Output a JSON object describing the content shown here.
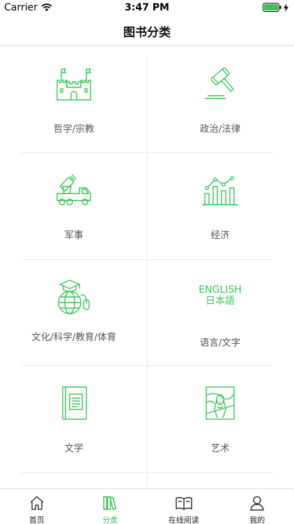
{
  "status_bar": {
    "carrier": "Carrier",
    "time": "3:47 PM"
  },
  "header": {
    "title": "图书分类"
  },
  "categories": [
    {
      "label": "哲学/宗教",
      "icon": "castle-icon"
    },
    {
      "label": "政治/法律",
      "icon": "gavel-icon"
    },
    {
      "label": "军事",
      "icon": "military-truck-icon"
    },
    {
      "label": "经济",
      "icon": "bar-chart-icon"
    },
    {
      "label": "文化/科学/教育/体育",
      "icon": "globe-graduation-icon"
    },
    {
      "label": "语言/文字",
      "icon": "english-japanese-icon",
      "icon_text": [
        "ENGLISH",
        "日本語"
      ]
    },
    {
      "label": "文学",
      "icon": "book-icon"
    },
    {
      "label": "艺术",
      "icon": "scream-painting-icon"
    }
  ],
  "tabs": [
    {
      "label": "首页",
      "icon": "home-icon",
      "active": false
    },
    {
      "label": "分类",
      "icon": "books-icon",
      "active": true
    },
    {
      "label": "在线阅读",
      "icon": "open-book-icon",
      "active": false
    },
    {
      "label": "我的",
      "icon": "profile-icon",
      "active": false
    }
  ],
  "colors": {
    "accent": "#34c556",
    "label": "#555555",
    "divider": "#ececec"
  }
}
